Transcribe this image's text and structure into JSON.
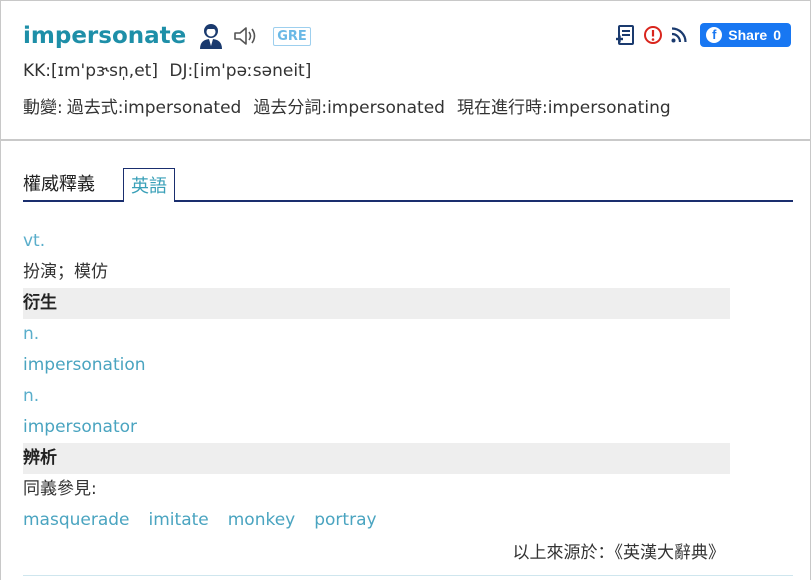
{
  "entry": {
    "headword": "impersonate",
    "level_badge": "GRE",
    "pronunciation_kk": "KK:[ɪm'pɝsn̩,et]",
    "pronunciation_dj": "DJ:[im'pəːsəneit]",
    "forms": {
      "label": "動變:",
      "past": "過去式:impersonated",
      "past_participle": "過去分詞:impersonated",
      "present_participle": "現在進行時:impersonating"
    }
  },
  "toolbar": {
    "icons": [
      "wordbook-icon",
      "report-icon",
      "rss-icon"
    ],
    "share_label": "Share",
    "share_count": "0",
    "colors": {
      "share_bg": "#1877f2",
      "headword": "#1e8fa8"
    }
  },
  "tabs": {
    "authority": "權威釋義",
    "english": "英語"
  },
  "definitions": {
    "pos_vt": "vt.",
    "meaning": "扮演；模仿",
    "derivatives_head": "衍生",
    "deriv1_pos": "n.",
    "deriv1_word": "impersonation",
    "deriv2_pos": "n.",
    "deriv2_word": "impersonator",
    "analysis_head": "辨析",
    "synonym_label": "同義參見:",
    "synonyms": [
      "masquerade",
      "imitate",
      "monkey",
      "portray"
    ]
  },
  "source": "以上來源於：《英漢大辭典》"
}
